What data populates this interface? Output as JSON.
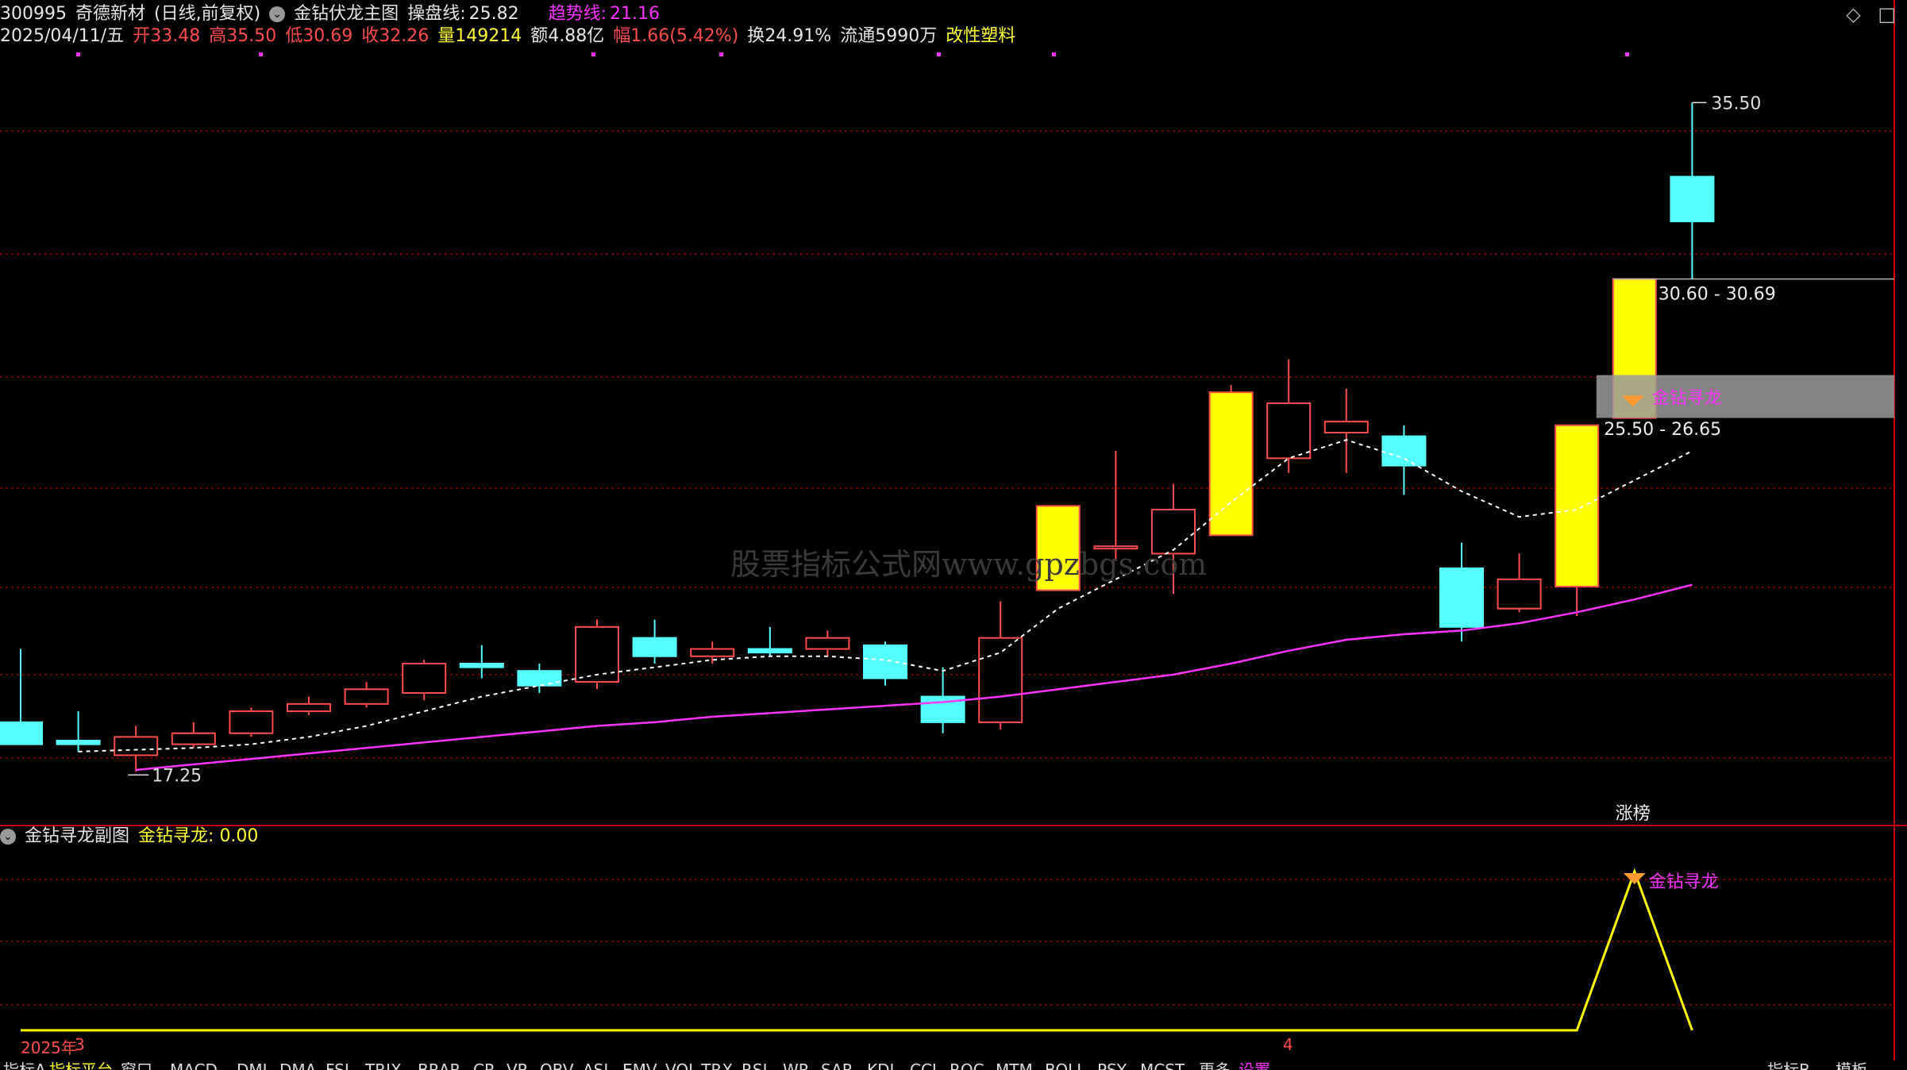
{
  "header": {
    "code": "300995",
    "name": "奇德新材",
    "period": "(日线,前复权)",
    "main_indicator": "金钻伏龙主图",
    "line1_label": "操盘线:",
    "line1_value": "25.82",
    "line2_label": "趋势线:",
    "line2_value": "21.16",
    "date": "2025/04/11/五",
    "open_label": "开",
    "open": "33.48",
    "high_label": "高",
    "high": "35.50",
    "low_label": "低",
    "low": "30.69",
    "close_label": "收",
    "close": "32.26",
    "vol_label": "量",
    "vol": "149214",
    "amt_label": "额",
    "amt": "4.88亿",
    "chg_label": "幅",
    "chg": "1.66(5.42%)",
    "turn_label": "换",
    "turn": "24.91%",
    "float_label": "流通",
    "float": "5990万",
    "sector": "改性塑料"
  },
  "icons": {
    "tr1": "◇",
    "tr2": "□"
  },
  "annotations": {
    "high_price": "35.50",
    "low_price": "17.25",
    "range1": "30.60 - 30.69",
    "range2": "25.50 - 26.65",
    "signal": "金钻寻龙",
    "zhangbang": "涨榜",
    "sub_signal": "金钻寻龙"
  },
  "watermark": "股票指标公式网www.gpzbgs.com",
  "sub": {
    "name": "金钻寻龙副图",
    "label": "金钻寻龙:",
    "value": "0.00"
  },
  "axis": {
    "year": "2025年",
    "m3": "3",
    "m4": "4"
  },
  "tabs": [
    "指标A",
    "指标平台",
    "窗口",
    "MACD",
    "DMI",
    "DMA",
    "FSL",
    "TRIX",
    "BRAR",
    "CR",
    "VR",
    "OBV",
    "ASI",
    "EMV",
    "VOL-TRX",
    "RSI",
    "WR",
    "SAR",
    "KDJ",
    "CCI",
    "ROC",
    "MTM",
    "BOLL",
    "PSY",
    "MCST",
    "更多",
    "设置",
    "指标B",
    "模板"
  ],
  "colors": {
    "up": "#ff4d4d",
    "down": "#55ffff",
    "yellow": "#ffff00",
    "trend": "#ff33ff",
    "grid": "#8b0000"
  },
  "chart_data": {
    "type": "candlestick",
    "candles": [
      {
        "o": 18.6,
        "h": 20.6,
        "l": 18.1,
        "c": 18.0
      },
      {
        "o": 18.1,
        "h": 18.9,
        "l": 17.8,
        "c": 18.0
      },
      {
        "o": 17.7,
        "h": 18.5,
        "l": 17.25,
        "c": 18.2
      },
      {
        "o": 18.0,
        "h": 18.6,
        "l": 17.9,
        "c": 18.3
      },
      {
        "o": 18.3,
        "h": 19.0,
        "l": 18.2,
        "c": 18.9
      },
      {
        "o": 18.9,
        "h": 19.3,
        "l": 18.8,
        "c": 19.1
      },
      {
        "o": 19.1,
        "h": 19.7,
        "l": 19.0,
        "c": 19.5
      },
      {
        "o": 19.4,
        "h": 20.3,
        "l": 19.2,
        "c": 20.2
      },
      {
        "o": 20.2,
        "h": 20.7,
        "l": 19.8,
        "c": 20.1
      },
      {
        "o": 20.0,
        "h": 20.2,
        "l": 19.4,
        "c": 19.6
      },
      {
        "o": 19.7,
        "h": 21.4,
        "l": 19.5,
        "c": 21.2
      },
      {
        "o": 20.9,
        "h": 21.4,
        "l": 20.2,
        "c": 20.4
      },
      {
        "o": 20.4,
        "h": 20.8,
        "l": 20.2,
        "c": 20.6
      },
      {
        "o": 20.6,
        "h": 21.2,
        "l": 20.4,
        "c": 20.5
      },
      {
        "o": 20.6,
        "h": 21.1,
        "l": 20.4,
        "c": 20.9
      },
      {
        "o": 20.7,
        "h": 20.8,
        "l": 19.6,
        "c": 19.8
      },
      {
        "o": 19.3,
        "h": 20.1,
        "l": 18.3,
        "c": 18.6
      },
      {
        "o": 18.6,
        "h": 21.9,
        "l": 18.4,
        "c": 20.9
      },
      {
        "o": 22.2,
        "h": 24.5,
        "l": 22.2,
        "c": 24.5
      },
      {
        "o": 23.4,
        "h": 26.0,
        "l": 23.0,
        "c": 23.4
      },
      {
        "o": 23.2,
        "h": 25.1,
        "l": 22.1,
        "c": 24.4
      },
      {
        "o": 23.7,
        "h": 27.8,
        "l": 23.7,
        "c": 27.6
      },
      {
        "o": 25.8,
        "h": 28.5,
        "l": 25.4,
        "c": 27.3
      },
      {
        "o": 26.5,
        "h": 27.7,
        "l": 25.4,
        "c": 26.8
      },
      {
        "o": 26.4,
        "h": 26.7,
        "l": 24.8,
        "c": 25.6
      },
      {
        "o": 22.8,
        "h": 23.5,
        "l": 20.8,
        "c": 21.2
      },
      {
        "o": 21.7,
        "h": 23.2,
        "l": 21.6,
        "c": 22.5
      },
      {
        "o": 22.3,
        "h": 26.7,
        "l": 21.5,
        "c": 26.7
      },
      {
        "o": 26.9,
        "h": 30.69,
        "l": 26.9,
        "c": 30.69
      },
      {
        "o": 33.48,
        "h": 35.5,
        "l": 30.69,
        "c": 32.26
      }
    ],
    "colors_special": [
      0,
      0,
      0,
      0,
      0,
      0,
      0,
      0,
      0,
      0,
      0,
      0,
      0,
      0,
      0,
      0,
      0,
      0,
      1,
      0,
      0,
      1,
      0,
      0,
      0,
      0,
      0,
      1,
      1,
      0
    ],
    "ma_white": [
      null,
      17.8,
      17.85,
      17.9,
      18.0,
      18.2,
      18.5,
      18.9,
      19.3,
      19.6,
      19.9,
      20.1,
      20.3,
      20.4,
      20.4,
      20.3,
      20.0,
      20.5,
      21.7,
      22.5,
      23.3,
      24.6,
      25.8,
      26.3,
      25.8,
      24.9,
      24.2,
      24.4,
      25.2,
      26.0
    ],
    "ma_trend": [
      null,
      null,
      17.3,
      17.45,
      17.6,
      17.75,
      17.9,
      18.05,
      18.2,
      18.35,
      18.5,
      18.6,
      18.75,
      18.85,
      18.95,
      19.05,
      19.15,
      19.3,
      19.5,
      19.7,
      19.9,
      20.2,
      20.55,
      20.85,
      21.0,
      21.1,
      21.3,
      21.6,
      21.95,
      22.35
    ],
    "ylim": [
      16.0,
      37.0
    ],
    "sub_signal": [
      0,
      0,
      0,
      0,
      0,
      0,
      0,
      0,
      0,
      0,
      0,
      0,
      0,
      0,
      0,
      0,
      0,
      0,
      0,
      0,
      0,
      0,
      0,
      0,
      0,
      0,
      0,
      0,
      1,
      0
    ]
  }
}
